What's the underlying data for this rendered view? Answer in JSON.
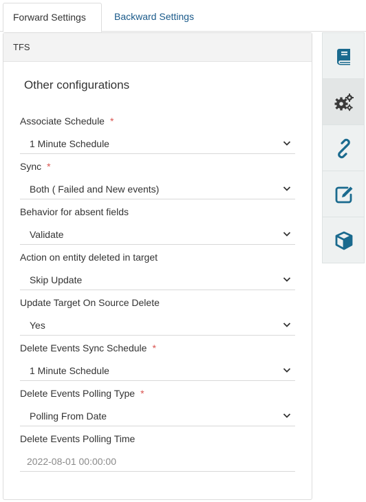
{
  "tabs": [
    {
      "label": "Forward Settings",
      "active": true
    },
    {
      "label": "Backward Settings",
      "active": false
    }
  ],
  "panel": {
    "header": "TFS",
    "section_title": "Other configurations"
  },
  "fields": [
    {
      "label": "Associate Schedule",
      "required": "*",
      "value": "1 Minute Schedule"
    },
    {
      "label": "Sync",
      "required": "*",
      "value": "Both ( Failed and New events)"
    },
    {
      "label": "Behavior for absent fields",
      "value": "Validate"
    },
    {
      "label": "Action on entity deleted in target",
      "value": "Skip Update"
    },
    {
      "label": "Update Target On Source Delete",
      "value": "Yes"
    },
    {
      "label": "Delete Events Sync Schedule",
      "required": "*",
      "value": "1 Minute Schedule"
    },
    {
      "label": "Delete Events Polling Type",
      "required": "*",
      "value": "Polling From Date"
    },
    {
      "label": "Delete Events Polling Time",
      "value": "2022-08-01 00:00:00"
    }
  ],
  "rail": {
    "icons": [
      "book-icon",
      "gears-icon",
      "link-icon",
      "edit-icon",
      "cube-icon"
    ],
    "active_index": 1
  },
  "colors": {
    "accent": "#1a6a8e",
    "required": "#d9534f",
    "link": "#1a5a8a",
    "gear": "#3a3a3a"
  }
}
